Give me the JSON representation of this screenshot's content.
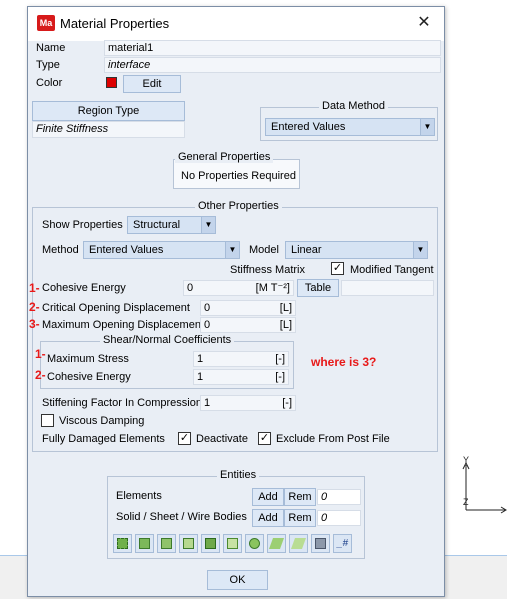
{
  "window": {
    "title": "Material Properties",
    "icon_text": "Ma",
    "close_icon": "close-icon"
  },
  "basic": {
    "name_label": "Name",
    "name_value": "material1",
    "type_label": "Type",
    "type_value": "interface",
    "color_label": "Color",
    "color_swatch": "#dd0000",
    "edit_label": "Edit"
  },
  "region_type": {
    "button": "Region Type",
    "value": "Finite Stiffness"
  },
  "data_method": {
    "title": "Data Method",
    "value": "Entered Values"
  },
  "general_properties": {
    "title": "General Properties",
    "value": "No Properties Required"
  },
  "other_properties": {
    "title": "Other Properties",
    "show_properties_label": "Show Properties",
    "show_properties_value": "Structural",
    "method_label": "Method",
    "method_value": "Entered Values",
    "model_label": "Model",
    "model_value": "Linear",
    "stiffness_matrix_label": "Stiffness Matrix",
    "modified_tangent_label": "Modified Tangent",
    "modified_tangent_checked": true,
    "cohesive_energy": {
      "number": "1-",
      "label": "Cohesive Energy",
      "value": "0",
      "unit": "[M T⁻²]",
      "table_button": "Table"
    },
    "critical_opening": {
      "number": "2-",
      "label": "Critical Opening Displacement",
      "value": "0",
      "unit": "[L]"
    },
    "maximum_opening": {
      "number": "3-",
      "label": "Maximum Opening Displacement",
      "value": "0",
      "unit": "[L]"
    },
    "shear_normal": {
      "title": "Shear/Normal Coefficients",
      "maximum_stress": {
        "number": "1-",
        "label": "Maximum Stress",
        "value": "1",
        "unit": "[-]"
      },
      "cohesive_energy": {
        "number": "2-",
        "label": "Cohesive Energy",
        "value": "1",
        "unit": "[-]"
      }
    },
    "annotation": "where is 3?",
    "stiffening": {
      "label": "Stiffening Factor In Compression",
      "value": "1",
      "unit": "[-]"
    },
    "viscous_damping_label": "Viscous Damping",
    "viscous_damping_checked": false,
    "fully_damaged_label": "Fully Damaged Elements",
    "deactivate_label": "Deactivate",
    "deactivate_checked": true,
    "exclude_label": "Exclude From Post File",
    "exclude_checked": true
  },
  "entities": {
    "title": "Entities",
    "elements_label": "Elements",
    "elements_value": "0",
    "bodies_label": "Solid / Sheet / Wire Bodies",
    "bodies_value": "0",
    "add_label": "Add",
    "rem_label": "Rem",
    "toolbar_icons": [
      "select-all-icon",
      "select-faces-icon",
      "select-edges-icon",
      "select-nodes-icon",
      "select-elements-icon",
      "select-box-icon",
      "select-shape-icon",
      "select-surface-icon",
      "select-curve-icon",
      "pick-list-icon",
      "id-number-icon"
    ]
  },
  "ok_label": "OK",
  "axes": {
    "y": "Y",
    "z": "Z"
  },
  "checkmark": "✓"
}
